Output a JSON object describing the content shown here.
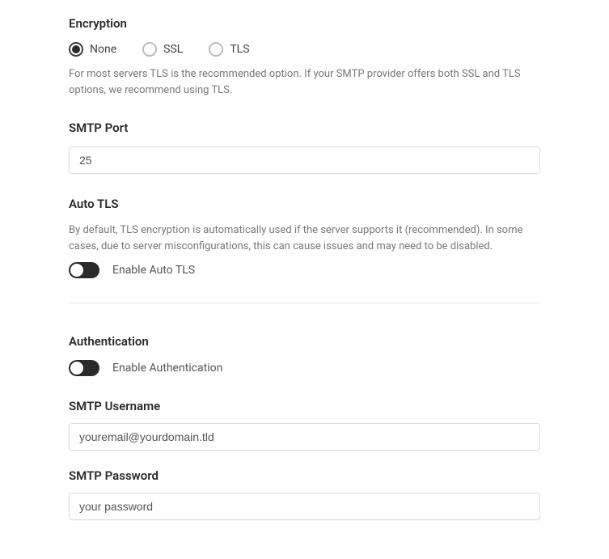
{
  "encryption": {
    "heading": "Encryption",
    "options": {
      "none": "None",
      "ssl": "SSL",
      "tls": "TLS"
    },
    "help": "For most servers TLS is the recommended option. If your SMTP provider offers both SSL and TLS options, we recommend using TLS."
  },
  "smtp_port": {
    "heading": "SMTP Port",
    "value": "25"
  },
  "auto_tls": {
    "heading": "Auto TLS",
    "help": "By default, TLS encryption is automatically used if the server supports it (recommended). In some cases, due to server misconfigurations, this can cause issues and may need to be disabled.",
    "toggle_label": "Enable Auto TLS"
  },
  "authentication": {
    "heading": "Authentication",
    "toggle_label": "Enable Authentication"
  },
  "smtp_username": {
    "heading": "SMTP Username",
    "value": "youremail@yourdomain.tld"
  },
  "smtp_password": {
    "heading": "SMTP Password",
    "value": "your password"
  }
}
